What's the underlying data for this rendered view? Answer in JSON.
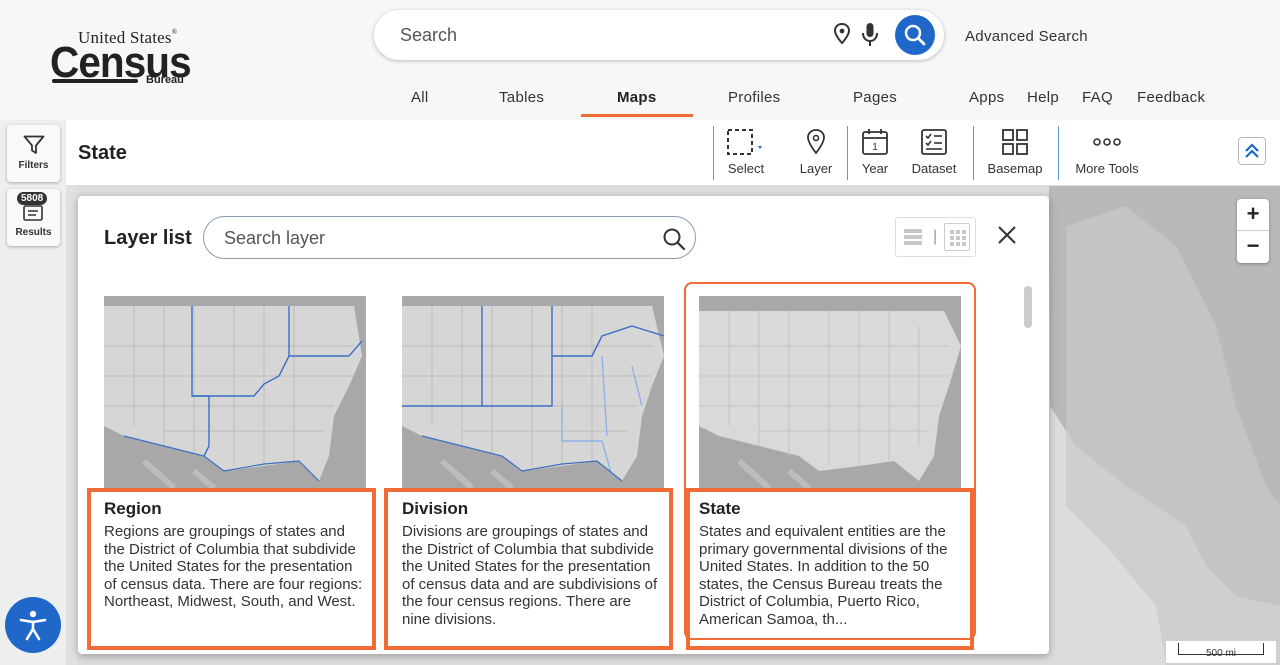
{
  "header": {
    "logo": {
      "line1": "United States",
      "reg": "®",
      "line2": "Census",
      "line3": "Bureau"
    },
    "search": {
      "placeholder": "Search"
    },
    "advanced_search": "Advanced Search",
    "tabs": [
      {
        "label": "All"
      },
      {
        "label": "Tables"
      },
      {
        "label": "Maps",
        "active": true
      },
      {
        "label": "Profiles"
      },
      {
        "label": "Pages"
      },
      {
        "label": "Apps"
      },
      {
        "label": "Help"
      },
      {
        "label": "FAQ"
      },
      {
        "label": "Feedback"
      }
    ]
  },
  "left_rail": {
    "filters_label": "Filters",
    "results_label": "Results",
    "results_count": "5808"
  },
  "toolbar": {
    "title": "State",
    "tools": [
      {
        "label": "Select",
        "icon": "dashed-select-icon"
      },
      {
        "label": "Layer",
        "icon": "map-pin-icon"
      },
      {
        "label": "Year",
        "icon": "calendar-icon"
      },
      {
        "label": "Dataset",
        "icon": "checklist-icon"
      },
      {
        "label": "Basemap",
        "icon": "grid-icon"
      },
      {
        "label": "More Tools",
        "icon": "more-dots-icon"
      }
    ],
    "year_badge": "1"
  },
  "panel": {
    "title": "Layer list",
    "search_placeholder": "Search layer",
    "view_divider": "|",
    "cards": [
      {
        "title": "Region",
        "description": "Regions are groupings of states and the District of Columbia that subdivide the United States for the presentation of census data. There are four regions: Northeast, Midwest, South, and West."
      },
      {
        "title": "Division",
        "description": "Divisions are groupings of states and the District of Columbia that subdivide the United States for the presentation of census data and are subdivisions of the four census regions. There are nine divisions."
      },
      {
        "title": "State",
        "description": "States and equivalent entities are the primary governmental divisions of the United States. In addition to the 50 states, the Census Bureau treats the District of Columbia, Puerto Rico, American Samoa, th..."
      }
    ]
  },
  "map": {
    "zoom_in": "+",
    "zoom_out": "−",
    "scale_label": "500 mi"
  },
  "colors": {
    "accent": "#f26a35",
    "brand_blue": "#1f68c9"
  }
}
